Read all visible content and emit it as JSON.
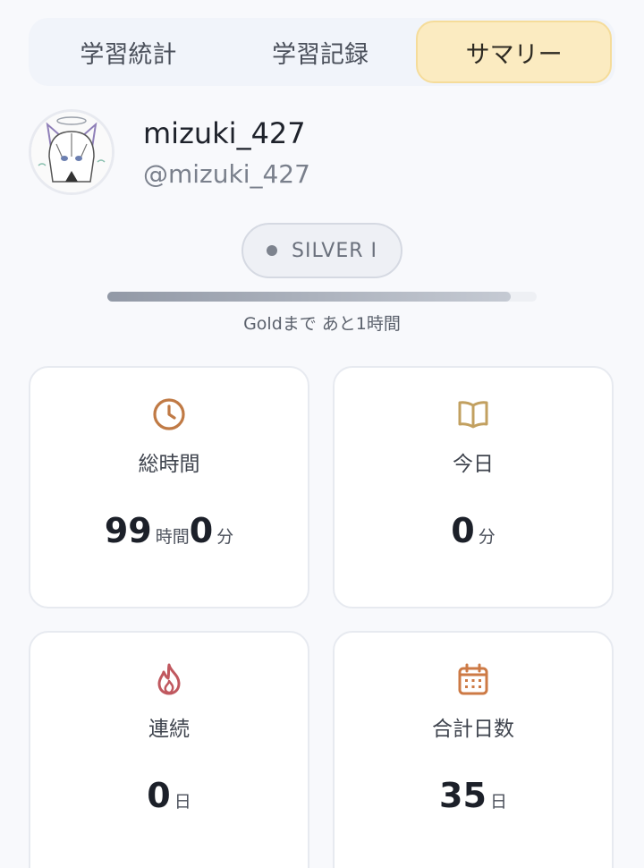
{
  "tabs": [
    {
      "label": "学習統計",
      "active": false
    },
    {
      "label": "学習記録",
      "active": false
    },
    {
      "label": "サマリー",
      "active": true
    }
  ],
  "profile": {
    "username": "mizuki_427",
    "handle": "@mizuki_427",
    "avatar_icon": "anime-avatar-image"
  },
  "rank": {
    "label": "SILVER I",
    "progress_fraction": 0.94,
    "next_text": "Goldまで あと1時間"
  },
  "stats": {
    "total": {
      "label": "総時間",
      "icon": "clock-icon",
      "color": "#c07a45",
      "hours": "99",
      "hours_unit": "時間",
      "minutes": "0",
      "minutes_unit": "分"
    },
    "today": {
      "label": "今日",
      "icon": "book-icon",
      "color": "#c2a060",
      "value": "0",
      "unit": "分"
    },
    "streak": {
      "label": "連続",
      "icon": "flame-icon",
      "color": "#c0585f",
      "value": "0",
      "unit": "日"
    },
    "days": {
      "label": "合計日数",
      "icon": "calendar-icon",
      "color": "#cd7a45",
      "value": "35",
      "unit": "日"
    }
  }
}
